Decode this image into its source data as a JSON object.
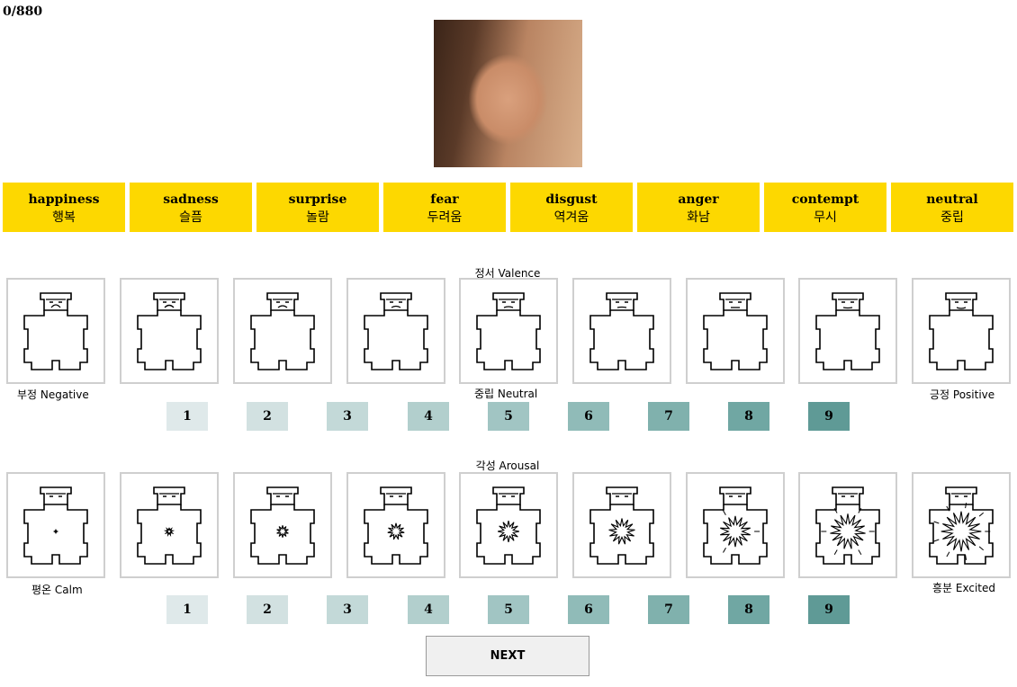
{
  "progress": "0/880",
  "emotions": [
    {
      "en": "happiness",
      "ko": "행복"
    },
    {
      "en": "sadness",
      "ko": "슬픔"
    },
    {
      "en": "surprise",
      "ko": "놀람"
    },
    {
      "en": "fear",
      "ko": "두려움"
    },
    {
      "en": "disgust",
      "ko": "역겨움"
    },
    {
      "en": "anger",
      "ko": "화남"
    },
    {
      "en": "contempt",
      "ko": "무시"
    },
    {
      "en": "neutral",
      "ko": "중립"
    }
  ],
  "valence": {
    "title": "정서 Valence",
    "anchor_low": "부정 Negative",
    "anchor_mid": "중립 Neutral",
    "anchor_high": "긍정 Positive",
    "numbers": [
      "1",
      "2",
      "3",
      "4",
      "5",
      "6",
      "7",
      "8",
      "9"
    ]
  },
  "arousal": {
    "title": "각성 Arousal",
    "anchor_low": "평온 Calm",
    "anchor_high": "흥분 Excited",
    "numbers": [
      "1",
      "2",
      "3",
      "4",
      "5",
      "6",
      "7",
      "8",
      "9"
    ]
  },
  "scale_colors": [
    "#dfe9ea",
    "#d2e1e1",
    "#c3d9d8",
    "#b2cfcd",
    "#a1c5c3",
    "#90bbb8",
    "#80b1ad",
    "#70a7a3",
    "#5f9a96"
  ],
  "next_label": "NEXT"
}
